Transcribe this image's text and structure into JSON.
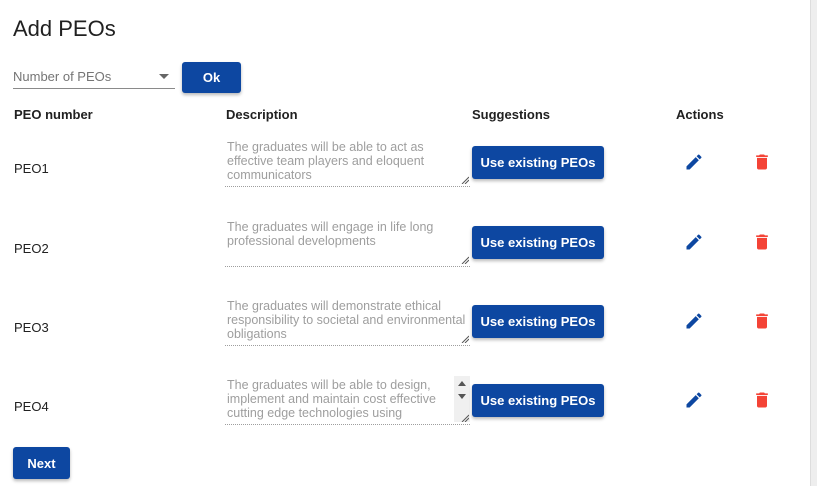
{
  "page": {
    "title": "Add PEOs"
  },
  "controls": {
    "select_label": "Number of PEOs",
    "ok_label": "Ok",
    "next_label": "Next"
  },
  "table": {
    "headers": {
      "peo_number": "PEO number",
      "description": "Description",
      "suggestions": "Suggestions",
      "actions": "Actions"
    },
    "rows": [
      {
        "peo": "PEO1",
        "description": "The graduates will be able to act as effective team players and eloquent communicators",
        "suggestion_label": "Use existing PEOs"
      },
      {
        "peo": "PEO2",
        "description": "The graduates will engage in life long professional developments",
        "suggestion_label": "Use existing PEOs"
      },
      {
        "peo": "PEO3",
        "description": "The graduates will demonstrate ethical responsibility to societal and environmental obligations",
        "suggestion_label": "Use existing PEOs"
      },
      {
        "peo": "PEO4",
        "description": "The graduates will be able to design, implement and maintain cost effective cutting edge technologies using",
        "suggestion_label": "Use existing PEOs"
      }
    ]
  },
  "icons": {
    "edit": "pencil-icon",
    "delete": "trash-icon",
    "dropdown": "chevron-down-icon"
  },
  "colors": {
    "primary_button": "#0d47a1",
    "edit_icon": "#0d47a1",
    "delete_icon": "#f44336",
    "placeholder_text": "#9e9e9e"
  }
}
